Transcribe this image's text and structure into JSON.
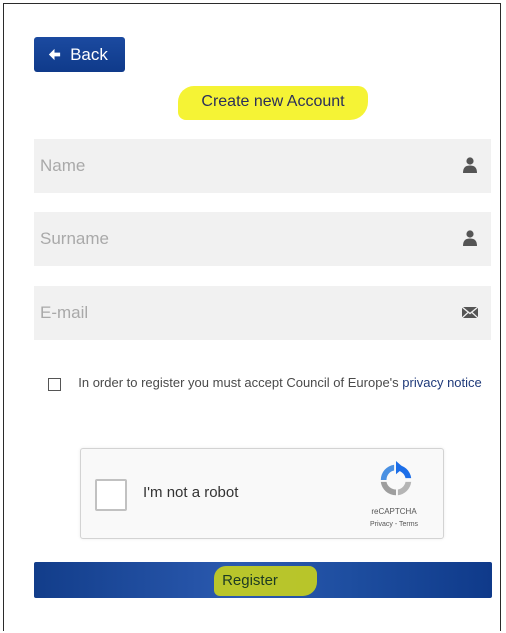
{
  "back_button": {
    "label": "Back",
    "icon": "arrow-left-icon"
  },
  "title": "Create new Account",
  "fields": {
    "name": {
      "placeholder": "Name",
      "icon": "user-icon"
    },
    "surname": {
      "placeholder": "Surname",
      "icon": "user-icon"
    },
    "email": {
      "placeholder": "E-mail",
      "icon": "envelope-icon"
    }
  },
  "consent": {
    "text": "In order to register you must accept Council of Europe's",
    "link": "privacy notice"
  },
  "captcha": {
    "label": "I'm not a robot",
    "brand": "reCAPTCHA",
    "legal": "Privacy - Terms"
  },
  "register_button": {
    "label": "Register"
  },
  "colors": {
    "primary": "#0f3a8a",
    "highlight": "#f4f22a",
    "field_bg": "#f1f1f1"
  }
}
